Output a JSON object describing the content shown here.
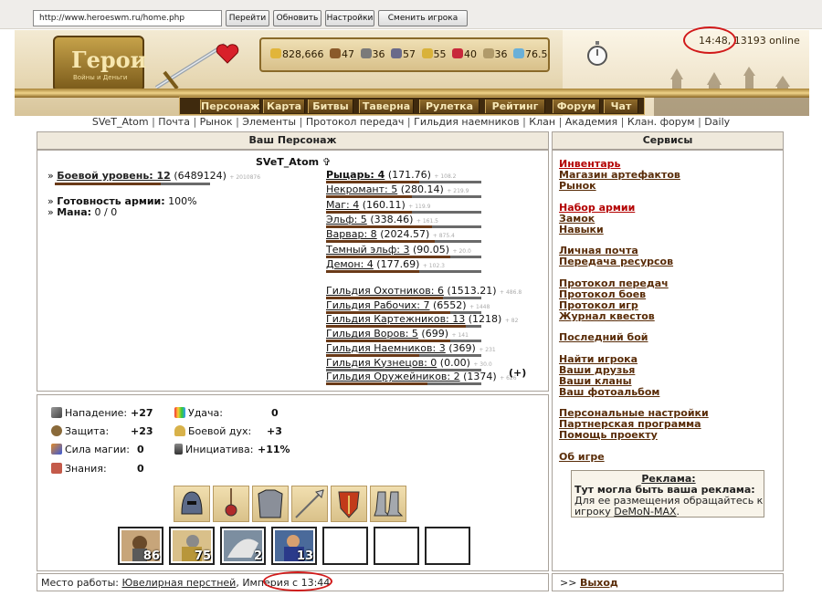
{
  "browser": {
    "url": "http://www.heroeswm.ru/home.php",
    "buttons": [
      "Перейти",
      "Обновить",
      "Настройки",
      "Сменить игрока"
    ]
  },
  "header": {
    "logo_title": "Герои",
    "logo_sub": "Войны и Деньги",
    "resources": [
      "828,666",
      "47",
      "36",
      "57",
      "55",
      "40",
      "36",
      "76.5"
    ],
    "time_online": "14:48, 13193 online",
    "menu": [
      "Персонаж",
      "Карта",
      "Битвы",
      "Таверна",
      "Рулетка",
      "Рейтинг",
      "Форум",
      "Чат"
    ]
  },
  "subnav": [
    "SVeT_Atom",
    "Почта",
    "Рынок",
    "Элементы",
    "Протокол передач",
    "Гильдия наемников",
    "Клан",
    "Академия",
    "Клан. форум",
    "Daily"
  ],
  "left_header": "Ваш Персонаж",
  "right_header": "Сервисы",
  "character": {
    "name": "SVeT_Atom",
    "level_label": "Боевой уровень: 12",
    "level_exp": "(6489124)",
    "level_next": "+ 2010876",
    "army_label": "Готовность армии:",
    "army_value": "100%",
    "mana_label": "Мана:",
    "mana_value": "0 / 0"
  },
  "factions": [
    {
      "name": "Рыцарь: 4",
      "val": "(171.76)",
      "sub": "+ 108.2",
      "fill": 0.6
    },
    {
      "name": "Некромант: 5",
      "val": "(280.14)",
      "sub": "+ 219.9",
      "fill": 0.55
    },
    {
      "name": "Маг: 4",
      "val": "(160.11)",
      "sub": "+ 119.9",
      "fill": 0.55
    },
    {
      "name": "Эльф: 5",
      "val": "(338.46)",
      "sub": "+ 161.5",
      "fill": 0.68
    },
    {
      "name": "Варвар: 8",
      "val": "(2024.57)",
      "sub": "+ 875.4",
      "fill": 0.7
    },
    {
      "name": "Темный эльф: 3",
      "val": "(90.05)",
      "sub": "+ 20.0",
      "fill": 0.8
    },
    {
      "name": "Демон: 4",
      "val": "(177.69)",
      "sub": "+ 102.3",
      "fill": 0.6
    }
  ],
  "guilds": [
    {
      "name": "Гильдия Охотников: 6",
      "val": "(1513.21)",
      "sub": "+ 486.8",
      "fill": 0.75
    },
    {
      "name": "Гильдия Рабочих: 7",
      "val": "(6552)",
      "sub": "+ 1448",
      "fill": 0.8
    },
    {
      "name": "Гильдия Картежников: 13",
      "val": "(1218)",
      "sub": "+ 82",
      "fill": 0.9
    },
    {
      "name": "Гильдия Воров: 5",
      "val": "(699)",
      "sub": "+ 141",
      "fill": 0.8
    },
    {
      "name": "Гильдия Наемников: 3",
      "val": "(369)",
      "sub": "+ 231",
      "fill": 0.6
    },
    {
      "name": "Гильдия Кузнецов: 0",
      "val": "(0.00)",
      "sub": "+ 30.0",
      "fill": 0
    },
    {
      "name": "Гильдия Оружейников: 2",
      "val": "(1374)",
      "sub": "+ 626",
      "fill": 0.65
    }
  ],
  "services": [
    {
      "label": "Инвентарь",
      "red": true
    },
    {
      "label": "Магазин артефактов",
      "red": false
    },
    {
      "label": "Рынок",
      "red": false
    },
    {
      "label": "Набор армии",
      "red": true
    },
    {
      "label": "Замок",
      "red": false
    },
    {
      "label": "Навыки",
      "red": false
    },
    {
      "label": "Личная почта",
      "red": false
    },
    {
      "label": "Передача ресурсов",
      "red": false
    },
    {
      "label": "Протокол передач",
      "red": false
    },
    {
      "label": "Протокол боев",
      "red": false
    },
    {
      "label": "Протокол игр",
      "red": false
    },
    {
      "label": "Журнал квестов",
      "red": false
    },
    {
      "label": "Последний бой",
      "red": false
    },
    {
      "label": "Найти игрока",
      "red": false
    },
    {
      "label": "Ваши друзья",
      "red": false
    },
    {
      "label": "Ваши кланы",
      "red": false
    },
    {
      "label": "Ваш фотоальбом",
      "red": false
    },
    {
      "label": "Персональные настройки",
      "red": false
    },
    {
      "label": "Партнерская программа",
      "red": false
    },
    {
      "label": "Помощь проекту",
      "red": false
    },
    {
      "label": "Об игре",
      "red": false
    }
  ],
  "ad": {
    "title": "Реклама:",
    "line1": "Тут могла быть ваша реклама:",
    "line2": "Для ее размещения обращайтесь к",
    "line3_pre": "игроку ",
    "line3_link": "DeMoN-MAX",
    "line3_post": "."
  },
  "attributes": {
    "attack_label": "Нападение:",
    "attack_val": "+27",
    "defense_label": "Защита:",
    "defense_val": "+23",
    "spell_label": "Сила магии:",
    "spell_val": "0",
    "knowledge_label": "Знания:",
    "knowledge_val": "0",
    "luck_label": "Удача:",
    "luck_val": "0",
    "morale_label": "Боевой дух:",
    "morale_val": "+3",
    "initiative_label": "Инициатива:",
    "initiative_val": "+11%"
  },
  "units": [
    "86",
    "75",
    "2",
    "13"
  ],
  "footer": {
    "work_label": "Место работы:",
    "work_place": "Ювелирная перстней",
    "work_rest": ", Империя с 13:44",
    "exit_prefix": ">>",
    "exit_label": "Выход"
  },
  "colors": {
    "accent": "#592c08",
    "link_red": "#b30000",
    "highlight": "#d11a1a"
  }
}
